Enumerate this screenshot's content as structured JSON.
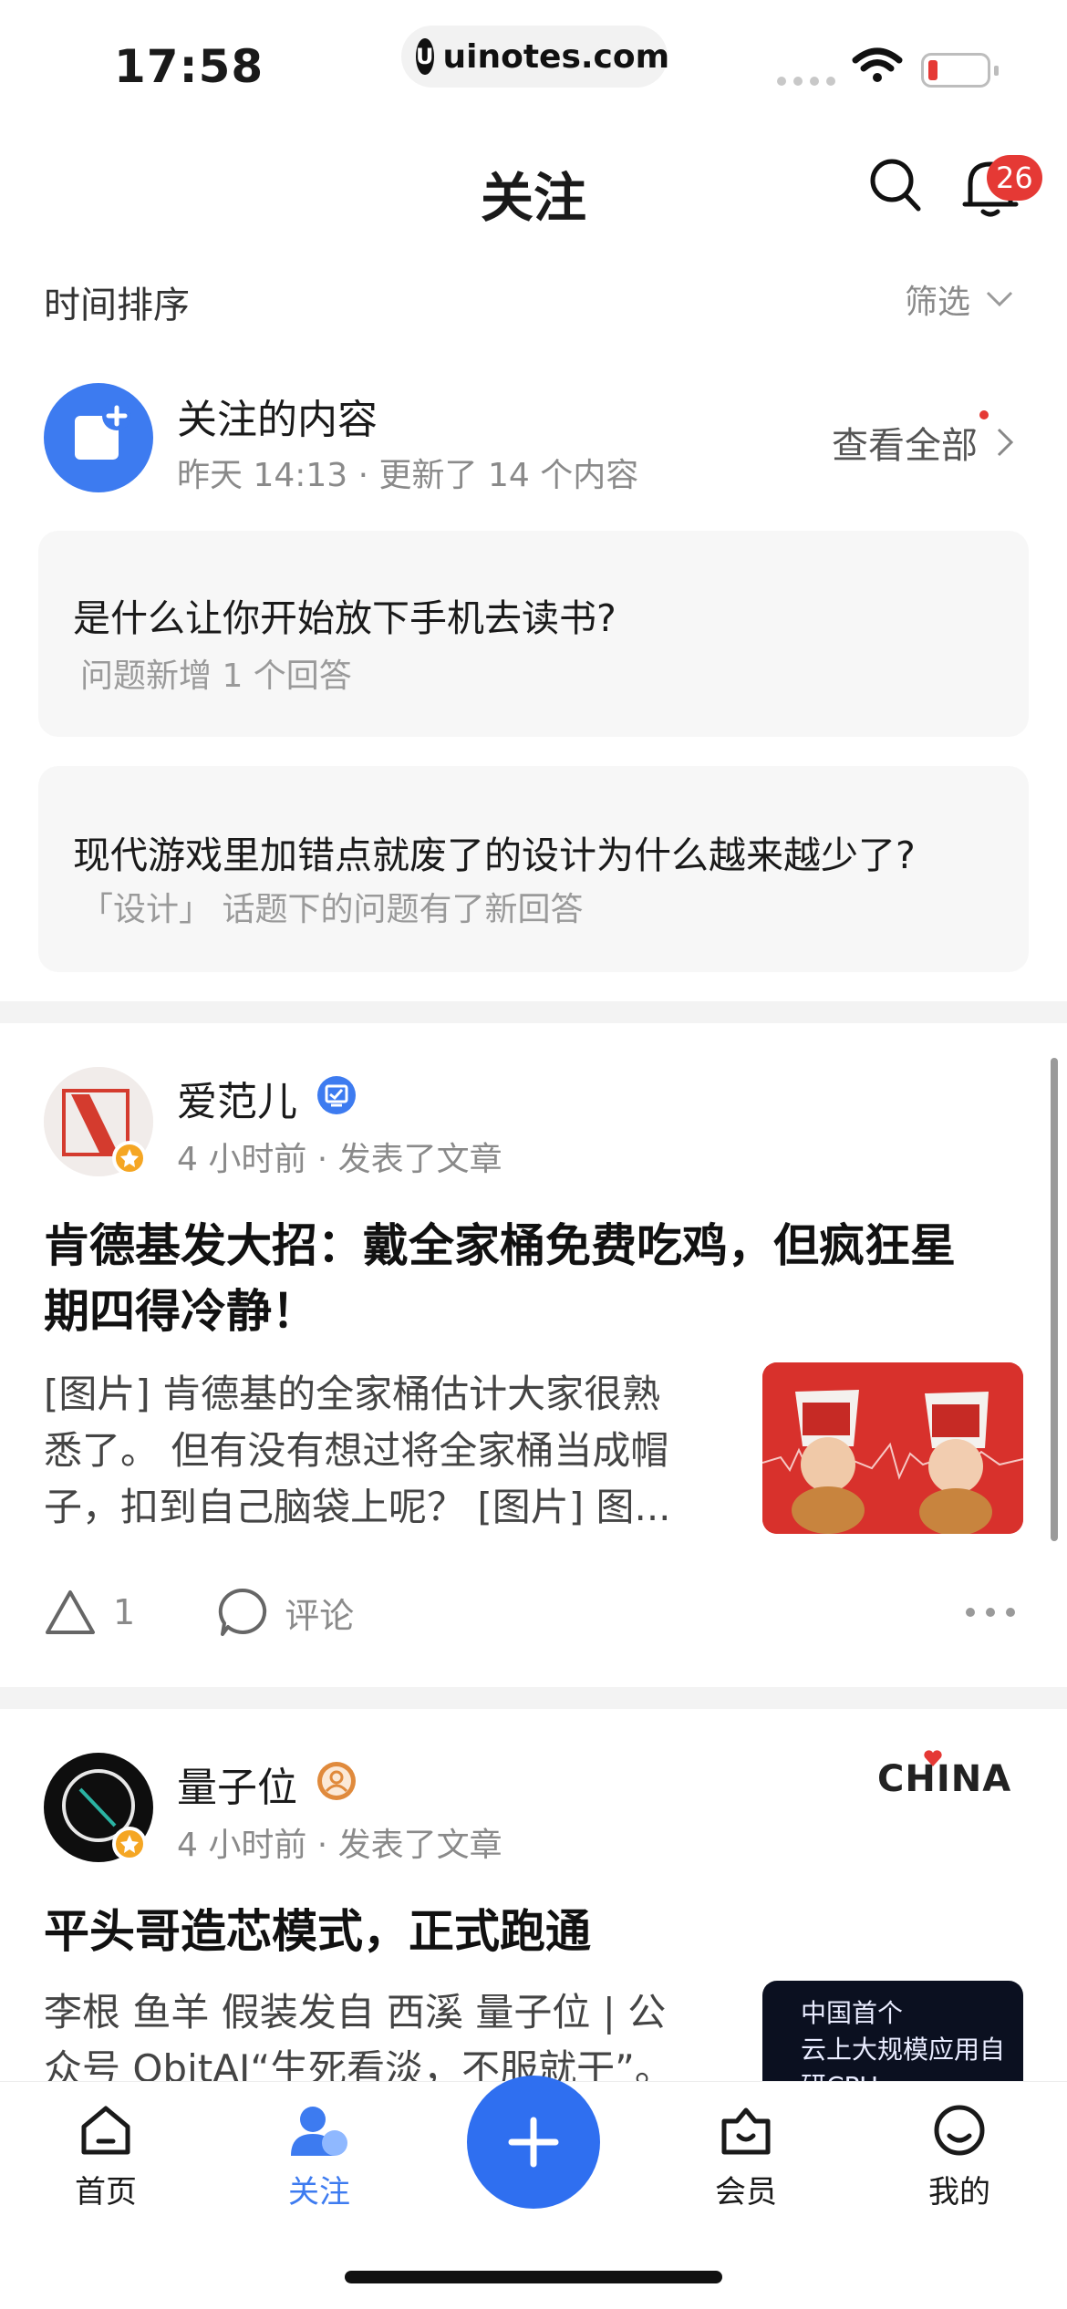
{
  "status_bar": {
    "time": "17:58",
    "url": "uinotes.com",
    "url_logo": "U"
  },
  "header": {
    "title": "关注",
    "notification_count": "26"
  },
  "sort": {
    "label": "时间排序",
    "filter_label": "筛选"
  },
  "follow_summary": {
    "title": "关注的内容",
    "meta": "昨天 14:13 · 更新了 14 个内容",
    "view_all": "查看全部"
  },
  "updates": [
    {
      "question": "是什么让你开始放下手机去读书?",
      "note": "问题新增 1 个回答"
    },
    {
      "question": "现代游戏里加错点就废了的设计为什么越来越少了?",
      "note": "「设计」 话题下的问题有了新回答"
    }
  ],
  "feed": [
    {
      "author": "爱范儿",
      "meta": "4 小时前 · 发表了文章",
      "headline_line1": "肯德基发大招：戴全家桶免费吃鸡，但疯狂星",
      "headline_line2": "期四得冷静！",
      "excerpt_line1": "[图片] 肯德基的全家桶估计大家很熟",
      "excerpt_line2": "悉了。 但有没有想过将全家桶当成帽",
      "excerpt_line3": "子，扣到自己脑袋上呢？ [图片] 图...",
      "likes": "1",
      "comment_label": "评论"
    },
    {
      "author": "量子位",
      "meta": "4 小时前 · 发表了文章",
      "brand_tag": "CHINA",
      "headline": "平头哥造芯模式，正式跑通",
      "excerpt_line1": "李根 鱼羊 假装发自 西溪 量子位 | 公",
      "excerpt_line2": "众号 QbitAI“生死看淡，不服就干”。",
      "thumb_text_line1": "中国首个",
      "thumb_text_line2": "云上大规模应用自研CPU"
    }
  ],
  "tabs": [
    {
      "label": "首页"
    },
    {
      "label": "关注"
    },
    {
      "label": "会员"
    },
    {
      "label": "我的"
    }
  ],
  "colors": {
    "accent": "#2f6ff0",
    "badge": "#e53935",
    "muted": "#8a8a8a"
  }
}
